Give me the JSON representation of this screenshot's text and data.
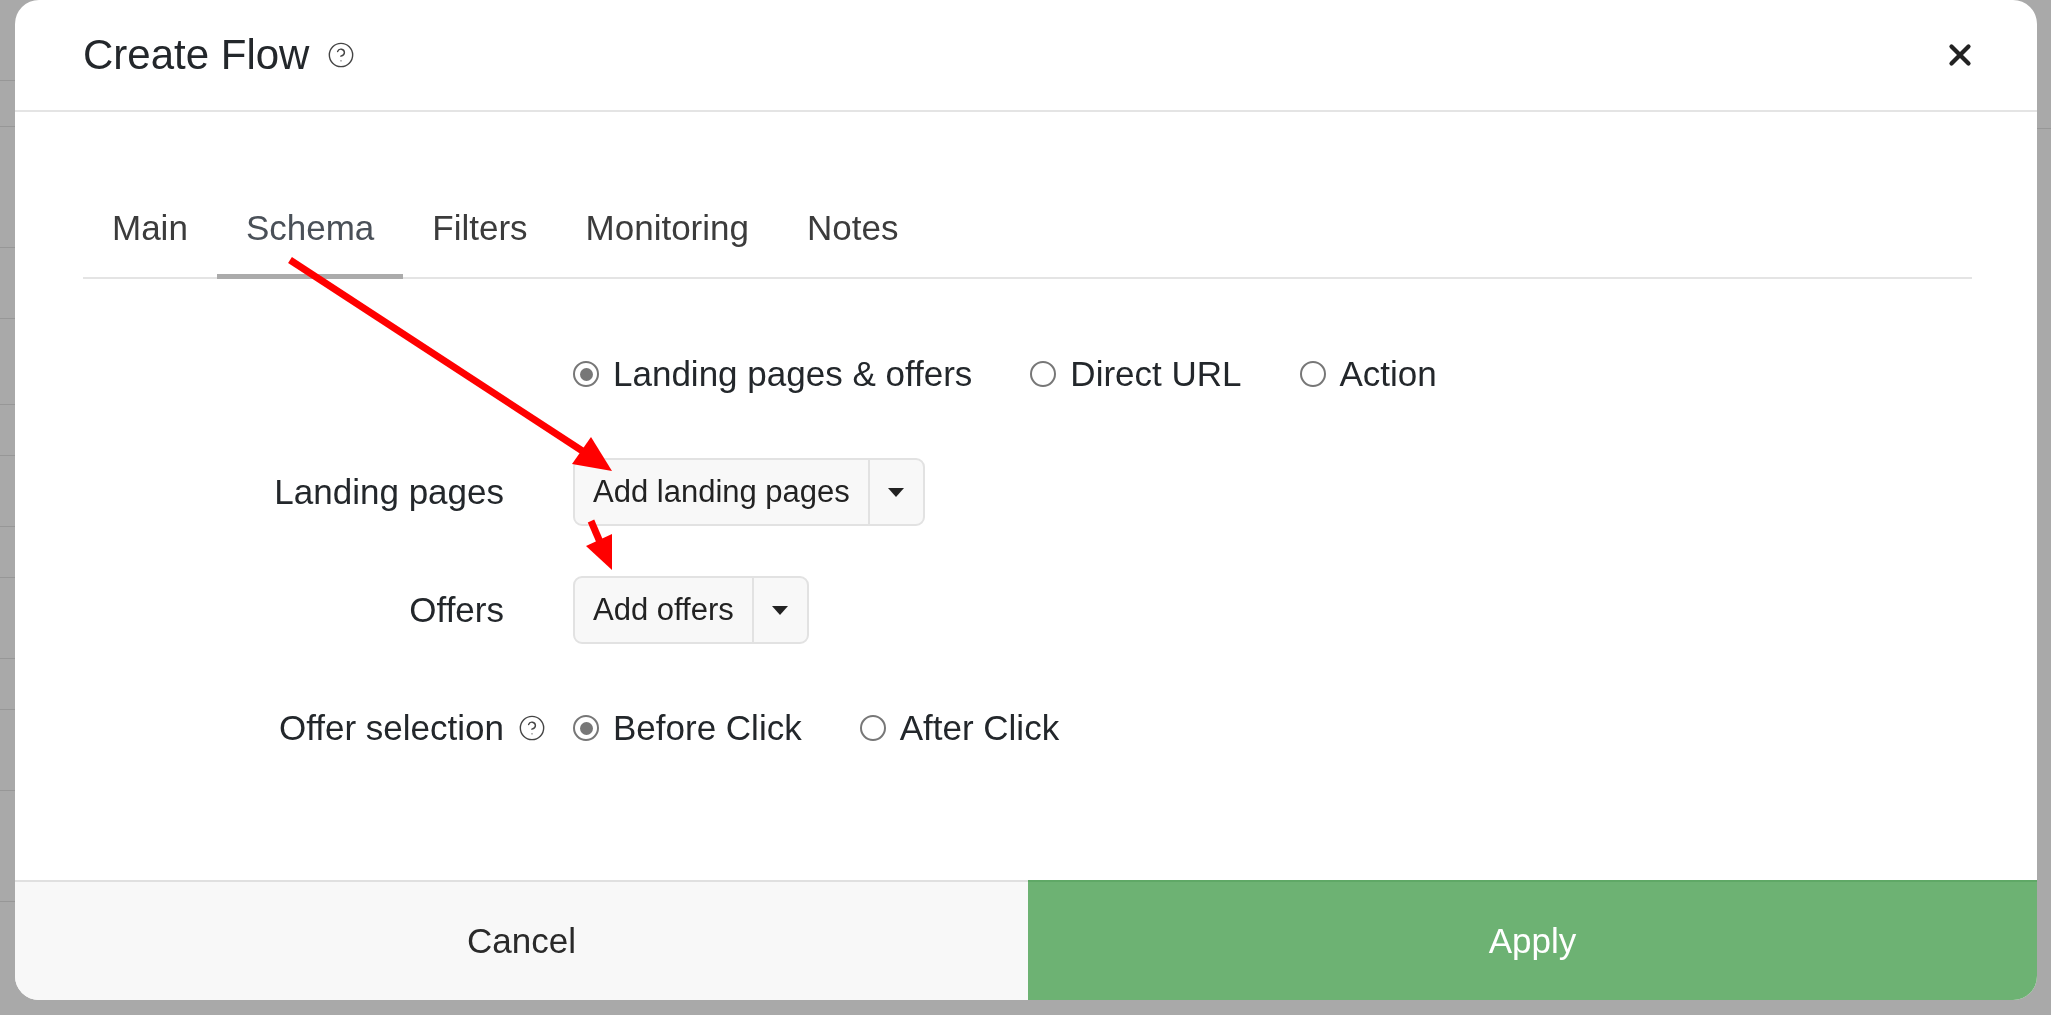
{
  "dialog": {
    "title": "Create Flow",
    "help": true,
    "tabs": [
      {
        "label": "Main",
        "selected": false
      },
      {
        "label": "Schema",
        "selected": true
      },
      {
        "label": "Filters",
        "selected": false
      },
      {
        "label": "Monitoring",
        "selected": false
      },
      {
        "label": "Notes",
        "selected": false
      }
    ],
    "schema_options": [
      {
        "label": "Landing pages & offers",
        "selected": true
      },
      {
        "label": "Direct URL",
        "selected": false
      },
      {
        "label": "Action",
        "selected": false
      }
    ],
    "fields": [
      {
        "kind": "dropdown",
        "label": "Landing pages",
        "help": false,
        "button": "Add landing pages"
      },
      {
        "kind": "dropdown",
        "label": "Offers",
        "help": false,
        "button": "Add offers"
      },
      {
        "kind": "radio",
        "label": "Offer selection",
        "help": true,
        "options": [
          {
            "label": "Before Click",
            "selected": true
          },
          {
            "label": "After Click",
            "selected": false
          }
        ]
      }
    ],
    "buttons": [
      {
        "kind": "cancel",
        "label": "Cancel"
      },
      {
        "kind": "apply",
        "label": "Apply"
      }
    ]
  }
}
